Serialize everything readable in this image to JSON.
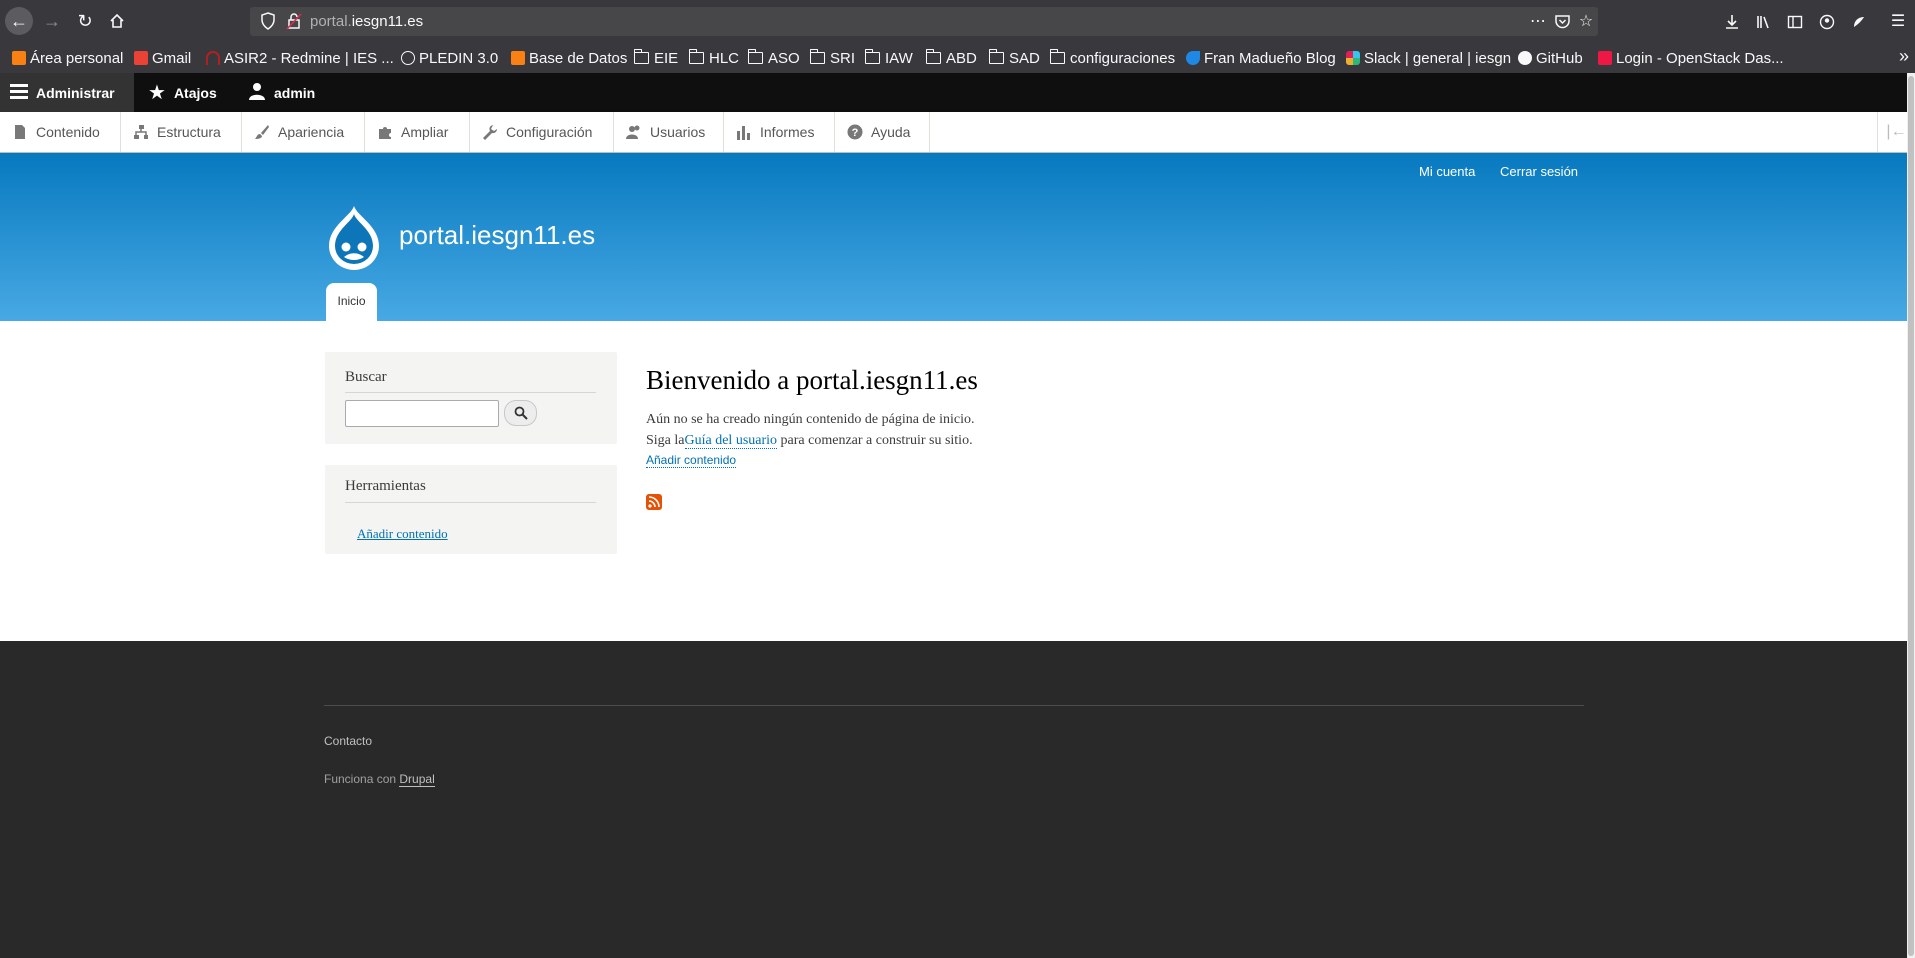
{
  "browser": {
    "url_prefix": "portal.",
    "url_domain": "iesgn11.es",
    "bookmarks": [
      "Área personal",
      "Gmail",
      "ASIR2 - Redmine | IES ...",
      "PLEDIN 3.0",
      "Base de Datos",
      "EIE",
      "HLC",
      "ASO",
      "SRI",
      "IAW",
      "ABD",
      "SAD",
      "configuraciones",
      "Fran Madueño Blog",
      "Slack | general | iesgn",
      "GitHub",
      "Login - OpenStack Das..."
    ]
  },
  "admin_toolbar": {
    "manage": "Administrar",
    "shortcuts": "Atajos",
    "user": "admin",
    "tray": [
      "Contenido",
      "Estructura",
      "Apariencia",
      "Ampliar",
      "Configuración",
      "Usuarios",
      "Informes",
      "Ayuda"
    ]
  },
  "header": {
    "secondary_menu": [
      "Mi cuenta",
      "Cerrar sesión"
    ],
    "site_name": "portal.iesgn11.es",
    "primary_tab": "Inicio"
  },
  "sidebar": {
    "search": {
      "title": "Buscar",
      "value": ""
    },
    "tools": {
      "title": "Herramientas",
      "link": "Añadir contenido"
    }
  },
  "content": {
    "title": "Bienvenido a portal.iesgn11.es",
    "line1": "Aún no se ha creado ningún contenido de página de inicio.",
    "line2_before": "Siga la",
    "line2_link": "Guía del usuario",
    "line2_after": " para comenzar a construir su sitio.",
    "add_content": "Añadir contenido"
  },
  "footer": {
    "contact": "Contacto",
    "powered_prefix": "Funciona con ",
    "powered_link": "Drupal"
  },
  "colors": {
    "header_top": "#0779bf",
    "header_bottom": "#48a9e4",
    "link": "#0071b3",
    "footer_bg": "#292929"
  }
}
